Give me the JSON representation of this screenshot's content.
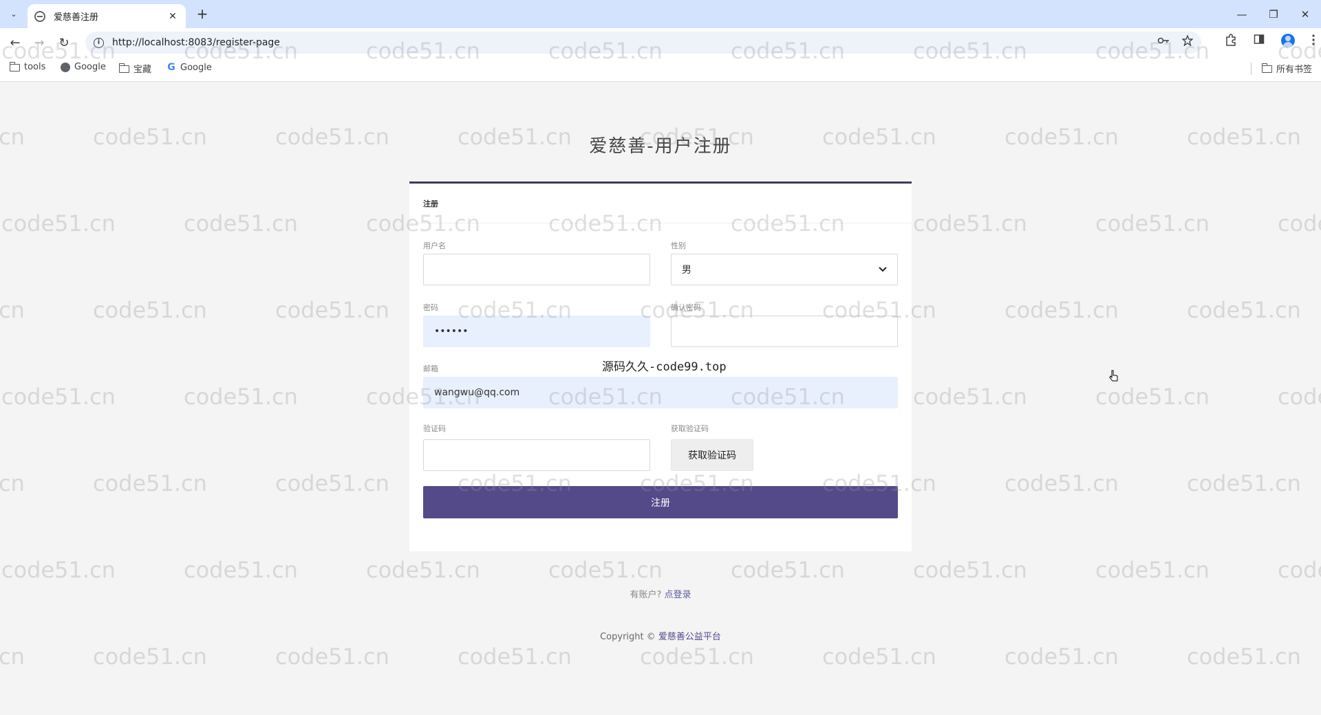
{
  "browser": {
    "tab_title": "爱慈善注册",
    "url": "http://localhost:8083/register-page",
    "bookmarks": [
      "tools",
      "Google",
      "宝藏",
      "Google"
    ],
    "all_bookmarks": "所有书签",
    "new_tab": "+",
    "close_tab": "✕",
    "tab_list": "⌄",
    "minimize": "—",
    "maximize": "❐",
    "close_window": "✕",
    "back": "←",
    "forward": "→",
    "reload": "↻",
    "info": "i",
    "icons": [
      "key-icon",
      "star-icon",
      "extensions-icon",
      "side-panel-icon",
      "profile-icon",
      "menu-icon"
    ]
  },
  "page": {
    "title": "爱慈善-用户注册",
    "card_header": "注册",
    "form": {
      "username_label": "用户名",
      "username_value": "",
      "gender_label": "性别",
      "gender_value": "男",
      "password_label": "密码",
      "password_value": "••••••",
      "confirm_label": "确认密码",
      "confirm_value": "",
      "email_label": "邮箱",
      "email_value": "wangwu@qq.com",
      "code_label": "验证码",
      "code_value": "",
      "get_code_label": "获取验证码",
      "get_code_button": "获取验证码",
      "submit": "注册"
    },
    "login_prompt": "有账户?",
    "login_link": "点登录",
    "copyright_prefix": "Copyright ©",
    "copyright_brand": "爱慈善公益平台"
  },
  "overlay_text": "源码久久-code99.top",
  "watermark": "code51.cn",
  "colors": {
    "accent": "#544a8a",
    "tabbar": "#d3e3fd",
    "autofill": "#e8f0fe"
  }
}
